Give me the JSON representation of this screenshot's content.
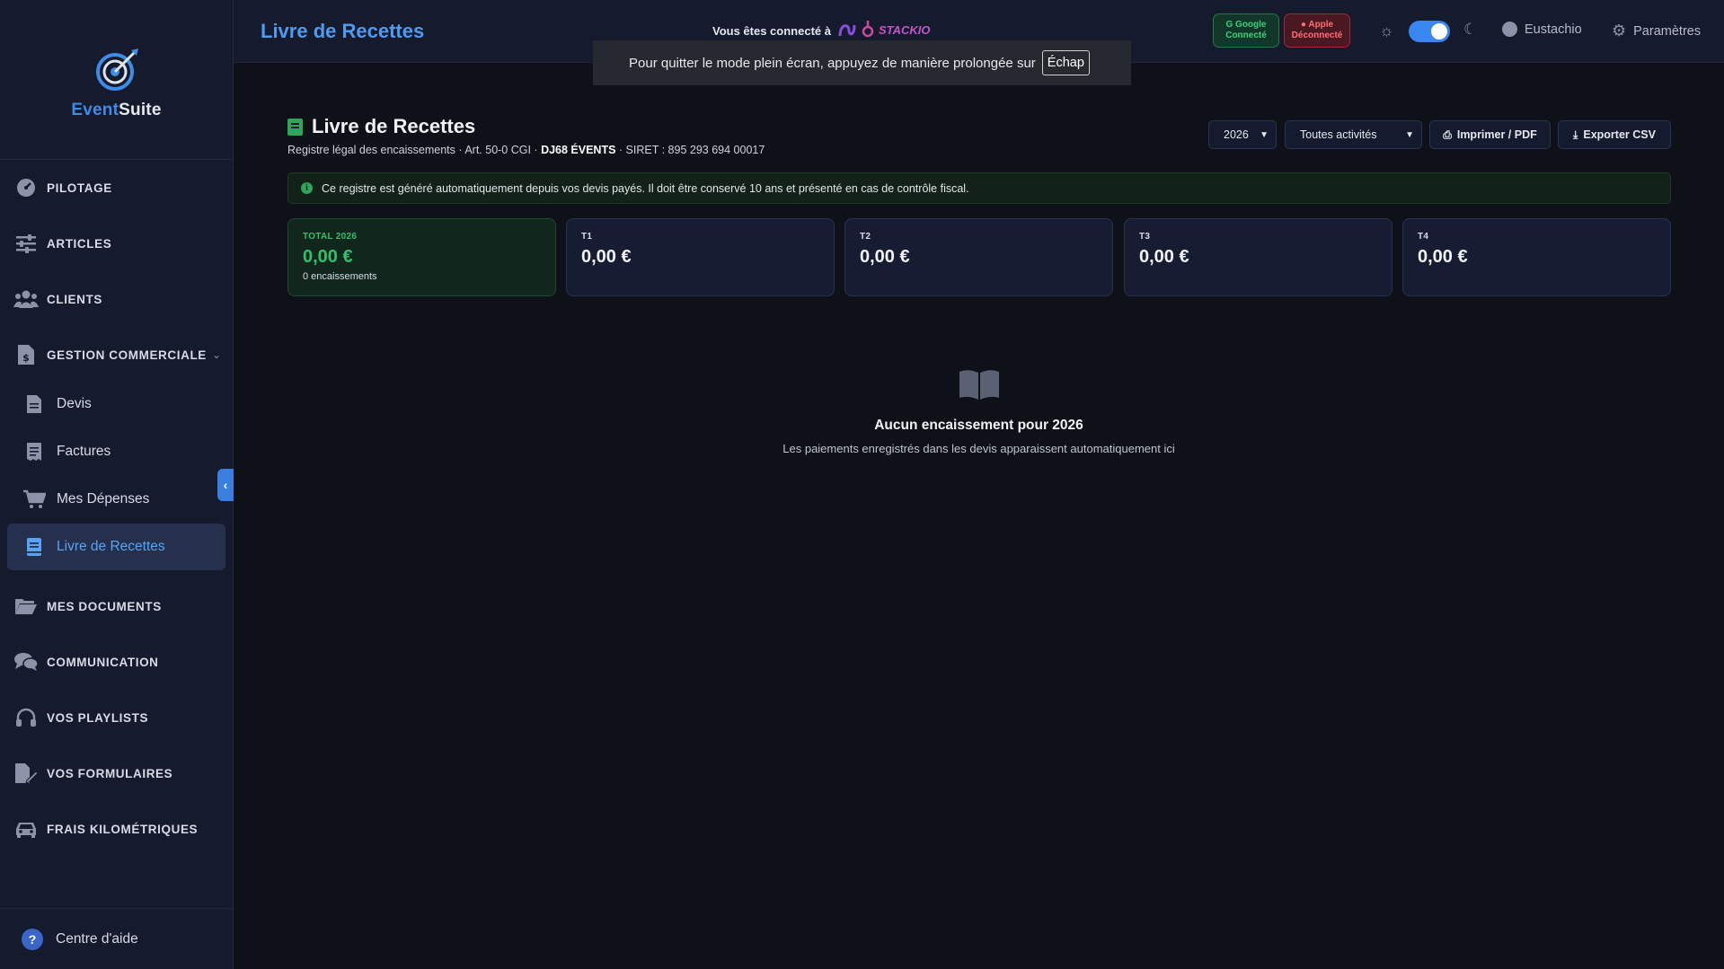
{
  "brand": {
    "name_part1": "Event",
    "name_part2": "Suite"
  },
  "sidebar": {
    "items": [
      {
        "label": "PILOTAGE",
        "icon": "gauge-icon"
      },
      {
        "label": "ARTICLES",
        "icon": "sliders-icon"
      },
      {
        "label": "CLIENTS",
        "icon": "users-icon"
      },
      {
        "label": "GESTION COMMERCIALE",
        "icon": "dollar-file-icon"
      },
      {
        "label": "MES DOCUMENTS",
        "icon": "folder-icon"
      },
      {
        "label": "COMMUNICATION",
        "icon": "chat-icon"
      },
      {
        "label": "VOS PLAYLISTS",
        "icon": "headphones-icon"
      },
      {
        "label": "VOS FORMULAIRES",
        "icon": "form-edit-icon"
      },
      {
        "label": "FRAIS KILOMÉTRIQUES",
        "icon": "car-icon"
      }
    ],
    "subitems": [
      {
        "label": "Devis",
        "icon": "file-icon"
      },
      {
        "label": "Factures",
        "icon": "receipt-icon"
      },
      {
        "label": "Mes Dépenses",
        "icon": "cart-icon"
      },
      {
        "label": "Livre de Recettes",
        "icon": "book-icon",
        "active": true
      }
    ],
    "help_label": "Centre d'aide"
  },
  "header": {
    "title": "Livre de Recettes",
    "connected_label": "Vous êtes connecté à",
    "partner_logo_text": "STACKIO",
    "google": {
      "name": "Google",
      "status": "Connecté"
    },
    "apple": {
      "name": "Apple",
      "status": "Déconnecté"
    },
    "user_name": "Eustachio",
    "settings_label": "Paramètres"
  },
  "fullscreen_notice": {
    "text": "Pour quitter le mode plein écran, appuyez de manière prolongée sur",
    "key": "Échap"
  },
  "main": {
    "title": "Livre de Recettes",
    "subtitle_prefix": "Registre légal des encaissements · Art. 50-0 CGI · ",
    "company": "DJ68 ÉVENTS",
    "subtitle_suffix": " · SIRET : 895 293 694 00017",
    "year_select": "2026",
    "activity_select": "Toutes activités",
    "print_label": "Imprimer / PDF",
    "csv_label": "Exporter CSV",
    "info": "Ce registre est généré automatiquement depuis vos devis payés. Il doit être conservé 10 ans et présenté en cas de contrôle fiscal.",
    "cards": [
      {
        "label": "TOTAL 2026",
        "value": "0,00 €",
        "sub": "0 encaissements"
      },
      {
        "label": "T1",
        "value": "0,00 €"
      },
      {
        "label": "T2",
        "value": "0,00 €"
      },
      {
        "label": "T3",
        "value": "0,00 €"
      },
      {
        "label": "T4",
        "value": "0,00 €"
      }
    ],
    "empty_title": "Aucun encaissement pour 2026",
    "empty_sub": "Les paiements enregistrés dans les devis apparaissent automatiquement ici"
  },
  "colors": {
    "accent": "#4f9bf0",
    "success": "#2ec26a",
    "danger": "#ff6f78",
    "sidebar_bg": "#151a2d",
    "page_bg": "#0e1117"
  }
}
